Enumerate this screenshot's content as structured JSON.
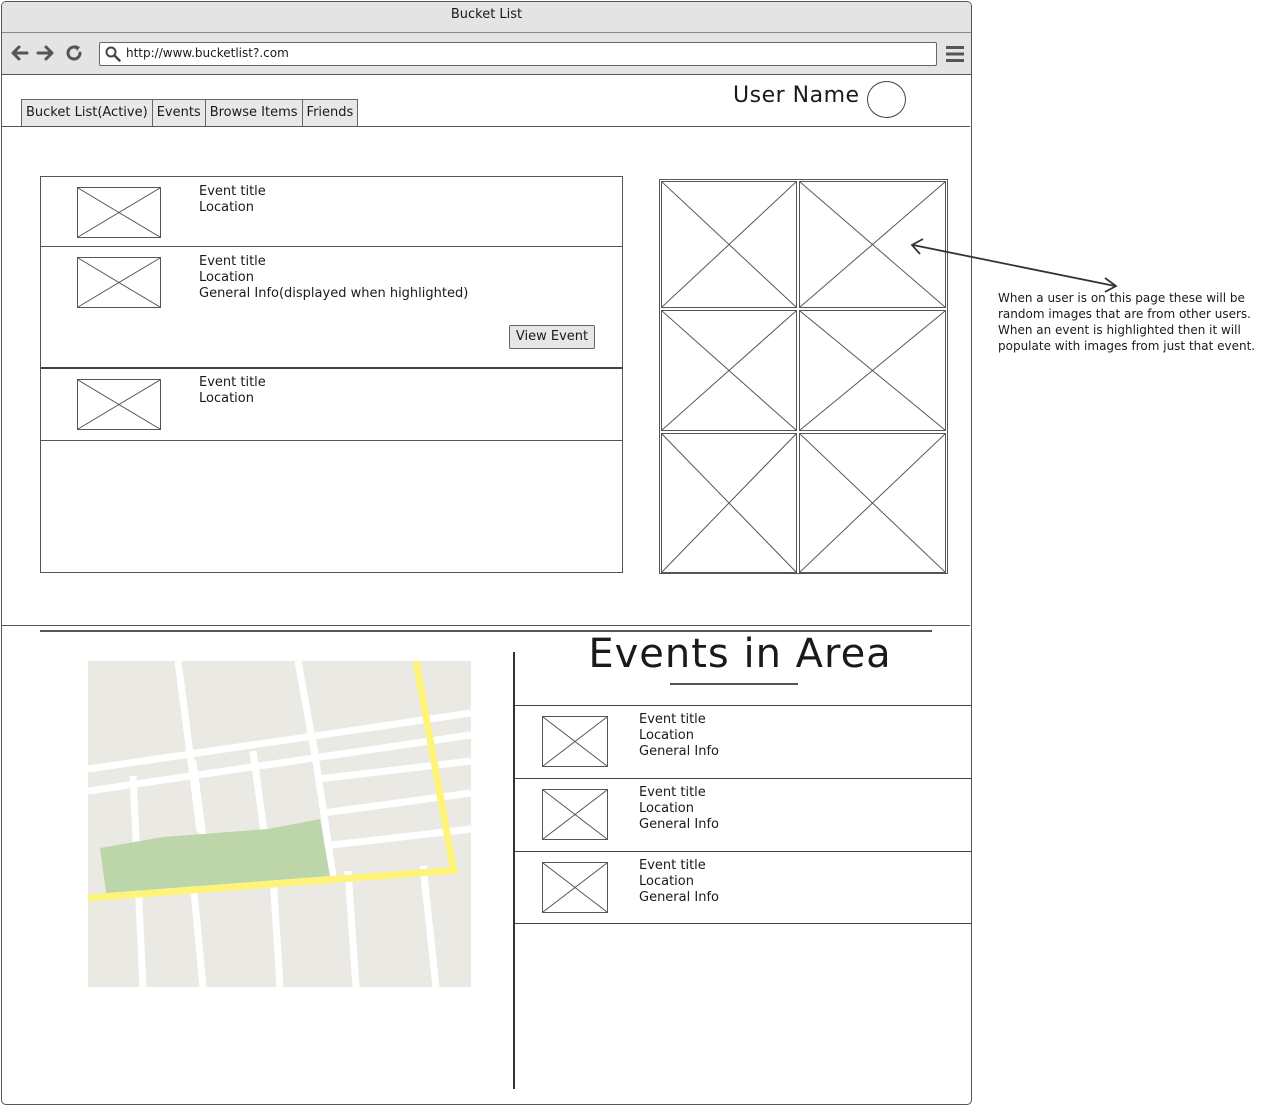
{
  "window": {
    "title": "Bucket List"
  },
  "browser": {
    "url": "http://www.bucketlist?.com",
    "icons": [
      "back-arrow-icon",
      "forward-arrow-icon",
      "refresh-icon",
      "search-icon",
      "menu-icon"
    ]
  },
  "tabs": [
    {
      "label": "Bucket List(Active)"
    },
    {
      "label": "Events"
    },
    {
      "label": "Browse Items"
    },
    {
      "label": "Friends"
    }
  ],
  "user": {
    "name": "User Name"
  },
  "event_list": [
    {
      "title": "Event title",
      "location": "Location"
    },
    {
      "title": "Event title",
      "location": "Location",
      "info": "General Info(displayed when highlighted)",
      "button": "View Event"
    },
    {
      "title": "Event title",
      "location": "Location"
    }
  ],
  "annotation": "When a user is on this page these will be random images that are from other users. When an event is highlighted then it will populate with images from just that event.",
  "area": {
    "title": "Events in Area",
    "events": [
      {
        "title": "Event title",
        "location": "Location",
        "info": "General Info"
      },
      {
        "title": "Event title",
        "location": "Location",
        "info": "General Info"
      },
      {
        "title": "Event title",
        "location": "Location",
        "info": "General Info"
      }
    ]
  },
  "colors": {
    "map_bg": "#ebe9e3",
    "map_road": "#ffffff",
    "map_highway": "#fff47a",
    "map_park": "#bdd6a9"
  }
}
